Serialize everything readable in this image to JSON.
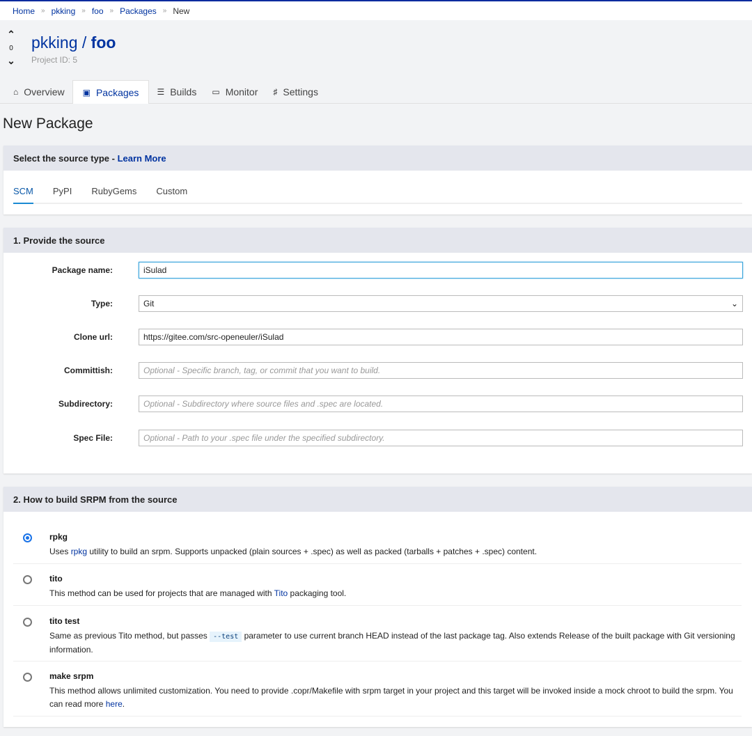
{
  "breadcrumb": [
    "Home",
    "pkking",
    "foo",
    "Packages"
  ],
  "breadcrumb_current": "New",
  "project": {
    "owner": "pkking",
    "name": "foo",
    "id_label": "Project ID: 5",
    "votes": "0"
  },
  "tabs": [
    {
      "label": "Overview",
      "icon": "home-icon"
    },
    {
      "label": "Packages",
      "icon": "archive-icon",
      "active": true
    },
    {
      "label": "Builds",
      "icon": "list-icon"
    },
    {
      "label": "Monitor",
      "icon": "monitor-icon"
    },
    {
      "label": "Settings",
      "icon": "sliders-icon"
    }
  ],
  "page_title": "New Package",
  "source": {
    "heading": "Select the source type - ",
    "learn_more": "Learn More",
    "types": [
      "SCM",
      "PyPI",
      "RubyGems",
      "Custom"
    ],
    "selected": "SCM"
  },
  "provide": {
    "heading": "1. Provide the source",
    "fields": [
      {
        "label": "Package name:",
        "value": "iSulad",
        "placeholder": ""
      },
      {
        "label": "Type:",
        "value": "Git"
      },
      {
        "label": "Clone url:",
        "value": "https://gitee.com/src-openeuler/iSulad",
        "placeholder": ""
      },
      {
        "label": "Committish:",
        "value": "",
        "placeholder": "Optional - Specific branch, tag, or commit that you want to build."
      },
      {
        "label": "Subdirectory:",
        "value": "",
        "placeholder": "Optional - Subdirectory where source files and .spec are located."
      },
      {
        "label": "Spec File:",
        "value": "",
        "placeholder": "Optional - Path to your .spec file under the specified subdirectory."
      }
    ]
  },
  "build": {
    "heading": "2. How to build SRPM from the source",
    "methods": [
      {
        "title": "rpkg",
        "selected": true,
        "d1": "Uses ",
        "link": "rpkg",
        "d2": " utility to build an srpm. Supports unpacked (plain sources + .spec) as well as packed (tarballs + patches + .spec) content."
      },
      {
        "title": "tito",
        "d1": "This method can be used for projects that are managed with ",
        "link": "Tito",
        "d2": " packaging tool."
      },
      {
        "title": "tito test",
        "d1": "Same as previous Tito method, but passes ",
        "code": "--test",
        "d2": " parameter to use current branch HEAD instead of the last package tag. Also extends Release of the built package with Git versioning information."
      },
      {
        "title": "make srpm",
        "d1": "This method allows unlimited customization. You need to provide .copr/Makefile with srpm target in your project and this target will be invoked inside a mock chroot to build the srpm. You can read more ",
        "link": "here",
        "d2": "."
      }
    ]
  }
}
